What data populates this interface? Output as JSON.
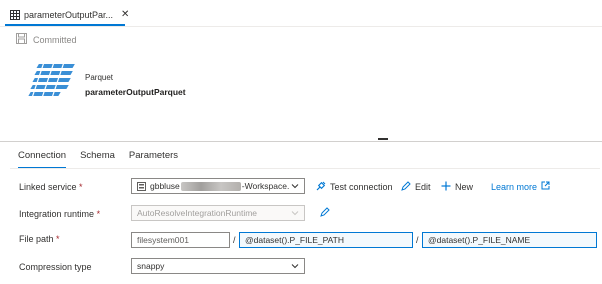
{
  "tab": {
    "title": "parameterOutputPar...",
    "close": "✕"
  },
  "toolbar": {
    "committed_label": "Committed"
  },
  "dataset": {
    "type": "Parquet",
    "name": "parameterOutputParquet"
  },
  "tabs": [
    {
      "label": "Connection",
      "active": true
    },
    {
      "label": "Schema",
      "active": false
    },
    {
      "label": "Parameters",
      "active": false
    }
  ],
  "form": {
    "linked_service": {
      "label": "Linked service",
      "required": "*",
      "value_prefix": "gbbluse",
      "value_suffix": "-Workspace.",
      "actions": {
        "test_connection": "Test connection",
        "edit": "Edit",
        "new": "New",
        "learn_more": "Learn more"
      }
    },
    "integration_runtime": {
      "label": "Integration runtime",
      "required": "*",
      "value": "AutoResolveIntegrationRuntime"
    },
    "file_path": {
      "label": "File path",
      "required": "*",
      "container": "filesystem001",
      "separator": "/",
      "directory": "@dataset().P_FILE_PATH",
      "file": "@dataset().P_FILE_NAME"
    },
    "compression": {
      "label": "Compression type",
      "value": "snappy"
    }
  },
  "colors": {
    "accent": "#0078d4",
    "required": "#a4262c",
    "parquet_blue": "#3a8fd6"
  }
}
